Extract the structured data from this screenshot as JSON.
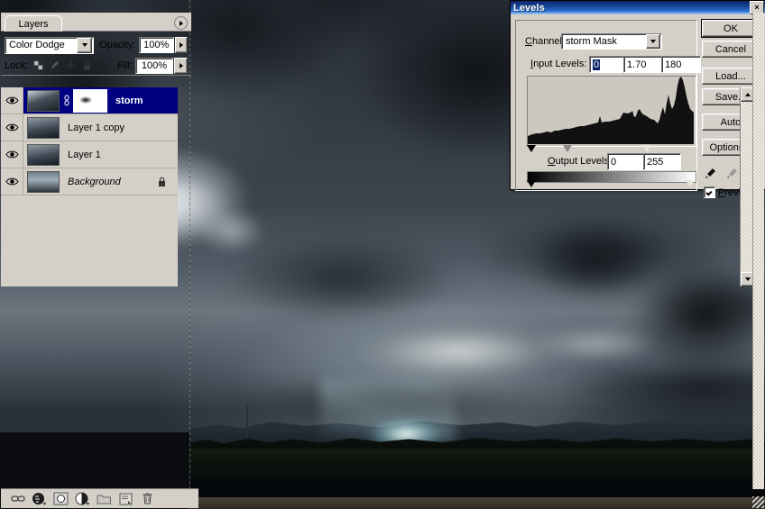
{
  "levels_dialog": {
    "title": "Levels",
    "close_label": "×",
    "channel_label": "Channel:",
    "channel_value": "storm Mask",
    "input_levels_label": "Input Levels:",
    "input_black": "0",
    "input_gamma": "1.70",
    "input_white": "180",
    "output_levels_label": "Output Levels:",
    "output_black": "0",
    "output_white": "255",
    "buttons": [
      {
        "label": "OK",
        "default": true
      },
      {
        "label": "Cancel",
        "default": false
      },
      {
        "label": "Load...",
        "default": false
      },
      {
        "label": "Save...",
        "default": false
      },
      {
        "label": "Auto",
        "default": false
      },
      {
        "label": "Options...",
        "default": false
      }
    ],
    "eyedroppers": [
      "black-point-eyedropper",
      "gray-point-eyedropper",
      "white-point-eyedropper"
    ],
    "preview_label": "Preview",
    "preview_checked": true
  },
  "layers_panel": {
    "minimize_label": "–",
    "close_label": "×",
    "tab_label": "Layers",
    "blend_mode": "Color Dodge",
    "opacity_label": "Opacity:",
    "opacity_value": "100%",
    "lock_label": "Lock:",
    "fill_label": "Fill:",
    "fill_value": "100%",
    "lock_icons": [
      "lock-transparency-icon",
      "lock-image-icon",
      "lock-position-icon",
      "lock-all-icon"
    ],
    "layers": [
      {
        "name": "storm",
        "selected": true,
        "visible": true,
        "has_mask": true,
        "italic": false,
        "locked": false
      },
      {
        "name": "Layer 1 copy",
        "selected": false,
        "visible": true,
        "has_mask": false,
        "italic": false,
        "locked": false
      },
      {
        "name": "Layer 1",
        "selected": false,
        "visible": true,
        "has_mask": false,
        "italic": false,
        "locked": false
      },
      {
        "name": "Background",
        "selected": false,
        "visible": true,
        "has_mask": false,
        "italic": true,
        "locked": true
      }
    ],
    "bottom_tools": [
      "link-layers-icon",
      "layer-style-icon",
      "add-layer-mask-icon",
      "new-adjustment-layer-icon",
      "new-group-icon",
      "new-layer-icon",
      "delete-layer-icon"
    ]
  },
  "canvas": {
    "description": "storm-clouds-photo"
  },
  "colors": {
    "titlebar_blue": "#0a246a",
    "dialog_face": "#d4d0c8",
    "selection_blue": "#000080",
    "histogram_bg": "#ccc8c0"
  }
}
